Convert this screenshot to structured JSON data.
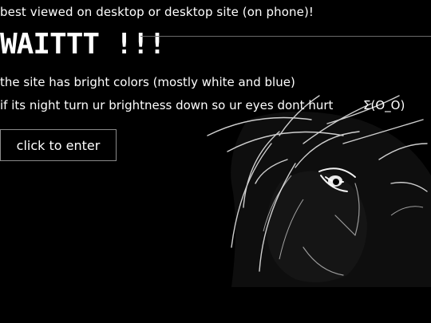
{
  "page": {
    "notice": "best viewed on desktop or desktop site (on phone)!",
    "heading": "WAITTT !!!",
    "line1": "the site has bright colors (mostly white and blue)",
    "line2": "if its night turn ur brightness down so ur eyes dont hurt",
    "emote": "Σ(O_O)",
    "enter_button": "click to enter"
  },
  "colors": {
    "background": "#000000",
    "text": "#ffffff",
    "button_border": "#8a8a8a"
  },
  "icons": {
    "background_art": "anime-character-lineart"
  }
}
